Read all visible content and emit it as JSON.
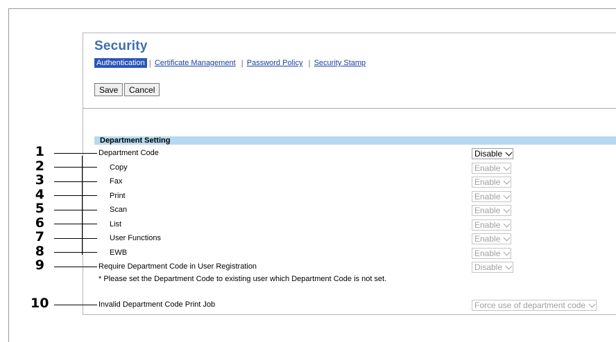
{
  "page": {
    "title": "Security",
    "tabs": [
      {
        "label": "Authentication",
        "active": true
      },
      {
        "label": "Certificate Management",
        "active": false
      },
      {
        "label": "Password Policy",
        "active": false
      },
      {
        "label": "Security Stamp",
        "active": false
      }
    ]
  },
  "toolbar": {
    "save_label": "Save",
    "cancel_label": "Cancel"
  },
  "section": {
    "title": "Department Setting"
  },
  "rows": [
    {
      "label": "Department Code",
      "value": "Disable",
      "enabled": true
    },
    {
      "label": "Copy",
      "value": "Enable",
      "enabled": false
    },
    {
      "label": "Fax",
      "value": "Enable",
      "enabled": false
    },
    {
      "label": "Print",
      "value": "Enable",
      "enabled": false
    },
    {
      "label": "Scan",
      "value": "Enable",
      "enabled": false
    },
    {
      "label": "List",
      "value": "Enable",
      "enabled": false
    },
    {
      "label": "User Functions",
      "value": "Enable",
      "enabled": false
    },
    {
      "label": "EWB",
      "value": "Enable",
      "enabled": false
    },
    {
      "label": "Require Department Code in User Registration",
      "value": "Disable",
      "enabled": false
    },
    {
      "label": "Invalid Department Code Print Job",
      "value": "Force use of department code",
      "enabled": false
    }
  ],
  "note": "* Please set the Department Code to existing user which Department Code is not set.",
  "callouts": [
    "1",
    "2",
    "3",
    "4",
    "5",
    "6",
    "7",
    "8",
    "9",
    "10"
  ]
}
